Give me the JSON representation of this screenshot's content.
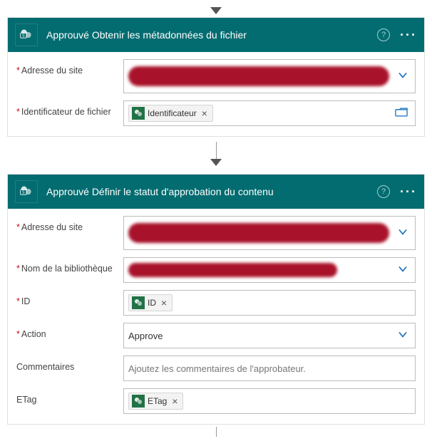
{
  "card1": {
    "title": "Approuvé Obtenir les métadonnées du fichier",
    "fields": {
      "siteAddress": {
        "label": "Adresse du site"
      },
      "fileId": {
        "label": "Identificateur de fichier",
        "token": "Identificateur"
      }
    }
  },
  "card2": {
    "title": "Approuvé Définir le statut d'approbation du contenu",
    "fields": {
      "siteAddress": {
        "label": "Adresse du site"
      },
      "library": {
        "label": "Nom de la bibliothèque"
      },
      "id": {
        "label": "ID",
        "token": "ID"
      },
      "action": {
        "label": "Action",
        "value": "Approve"
      },
      "comments": {
        "label": "Commentaires",
        "placeholder": "Ajoutez les commentaires de l'approbateur."
      },
      "etag": {
        "label": "ETag",
        "token": "ETag"
      }
    }
  }
}
